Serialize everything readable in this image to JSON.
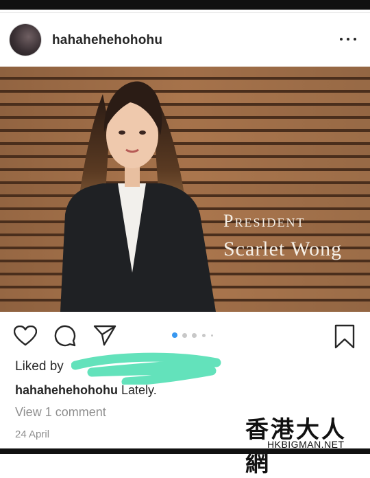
{
  "post": {
    "username": "hahahehehohohu",
    "photo": {
      "overlay_role": "President",
      "overlay_name": "Scarlet Wong"
    },
    "carousel": {
      "count": 5,
      "active": 1
    },
    "likes_prefix": "Liked by",
    "caption_user": "hahahehehohohu",
    "caption_text": "Lately.",
    "comments_link": "View 1 comment",
    "date": "24 April"
  },
  "watermark": {
    "chinese": "香港大人網",
    "latin": "HKBIGMAN.NET"
  },
  "colors": {
    "text": "#262626",
    "muted": "#8e8e8e",
    "carousel_active": "#3897f0",
    "redaction": "#5be0b7"
  },
  "icons": [
    "more-options-icon",
    "heart-icon",
    "comment-icon",
    "share-icon",
    "bookmark-icon"
  ]
}
